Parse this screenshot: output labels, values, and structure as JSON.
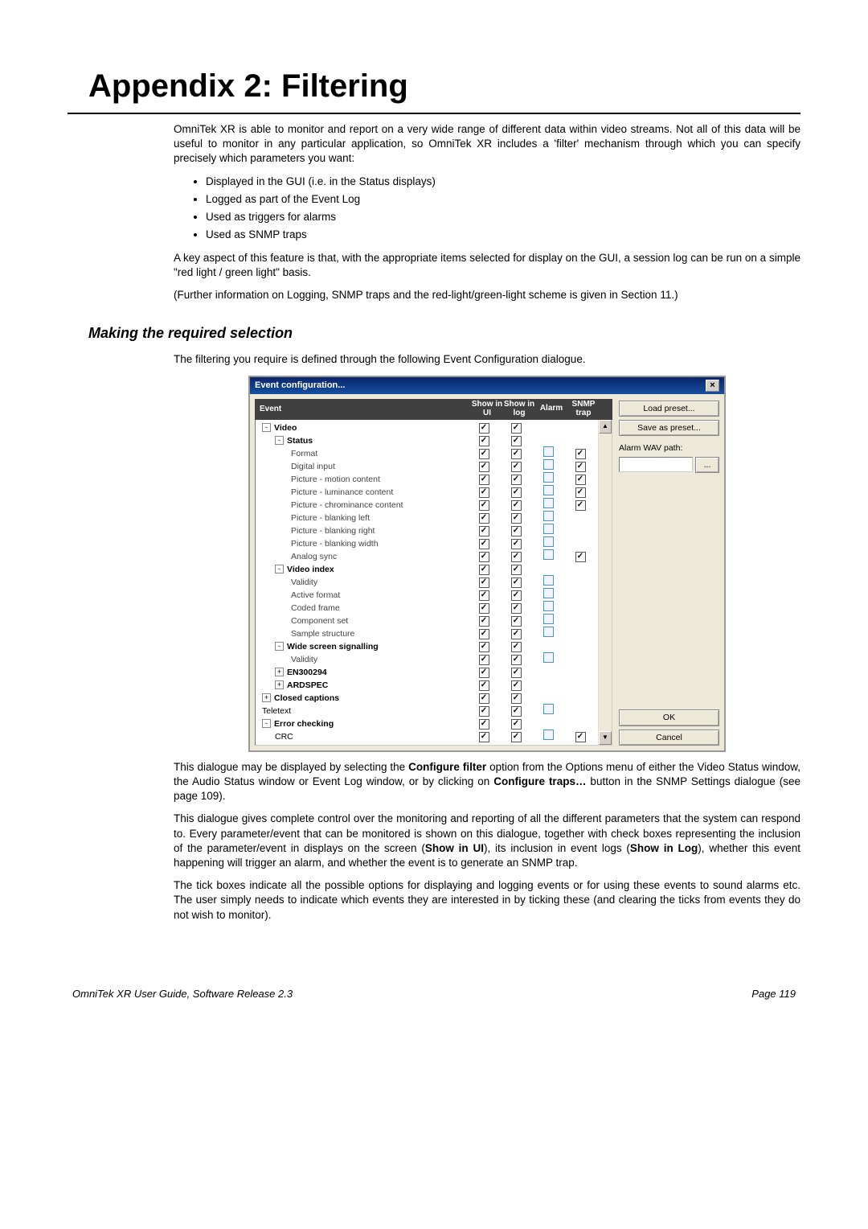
{
  "page_title": "Appendix 2: Filtering",
  "intro_para": "OmniTek XR is able to monitor and report on a very wide range of different data within video streams. Not all of this data will be useful to monitor in any particular application, so OmniTek XR includes a 'filter' mechanism through which you can specify precisely which parameters you want:",
  "bullets": [
    "Displayed in the GUI (i.e. in the Status displays)",
    "Logged as part of the Event Log",
    "Used as triggers for alarms",
    "Used as SNMP traps"
  ],
  "key_para": "A key aspect of this feature is that, with the appropriate items selected for display on the GUI, a session log can be run on a simple \"red light / green light\" basis.",
  "further_para": "(Further information on Logging, SNMP traps and the red-light/green-light scheme is given in Section 11.)",
  "section_heading": "Making the required selection",
  "section_intro": "The filtering you require is defined through the following Event Configuration dialogue.",
  "dialog": {
    "title": "Event configuration...",
    "headers": {
      "event": "Event",
      "ui": "Show in UI",
      "log": "Show in log",
      "alarm": "Alarm",
      "snmp": "SNMP trap"
    },
    "rows": [
      {
        "label": "Video",
        "indent": 1,
        "bold": true,
        "toggle": "-",
        "ui": "on",
        "log": "on",
        "alarm": "",
        "snmp": ""
      },
      {
        "label": "Status",
        "indent": 2,
        "bold": true,
        "toggle": "-",
        "ui": "on",
        "log": "on",
        "alarm": "",
        "snmp": ""
      },
      {
        "label": "Format",
        "indent": 3,
        "bold": false,
        "toggle": "",
        "ui": "on",
        "log": "on",
        "alarm": "off",
        "snmp": "on"
      },
      {
        "label": "Digital input",
        "indent": 3,
        "bold": false,
        "toggle": "",
        "ui": "on",
        "log": "on",
        "alarm": "off",
        "snmp": "on"
      },
      {
        "label": "Picture - motion content",
        "indent": 3,
        "bold": false,
        "toggle": "",
        "ui": "on",
        "log": "on",
        "alarm": "off",
        "snmp": "on"
      },
      {
        "label": "Picture - luminance content",
        "indent": 3,
        "bold": false,
        "toggle": "",
        "ui": "on",
        "log": "on",
        "alarm": "off",
        "snmp": "on"
      },
      {
        "label": "Picture - chrominance content",
        "indent": 3,
        "bold": false,
        "toggle": "",
        "ui": "on",
        "log": "on",
        "alarm": "off",
        "snmp": "on"
      },
      {
        "label": "Picture - blanking left",
        "indent": 3,
        "bold": false,
        "toggle": "",
        "ui": "on",
        "log": "on",
        "alarm": "off",
        "snmp": ""
      },
      {
        "label": "Picture - blanking right",
        "indent": 3,
        "bold": false,
        "toggle": "",
        "ui": "on",
        "log": "on",
        "alarm": "off",
        "snmp": ""
      },
      {
        "label": "Picture - blanking width",
        "indent": 3,
        "bold": false,
        "toggle": "",
        "ui": "on",
        "log": "on",
        "alarm": "off",
        "snmp": ""
      },
      {
        "label": "Analog sync",
        "indent": 3,
        "bold": false,
        "toggle": "",
        "ui": "on",
        "log": "on",
        "alarm": "off",
        "snmp": "on"
      },
      {
        "label": "Video index",
        "indent": 2,
        "bold": true,
        "toggle": "-",
        "ui": "on",
        "log": "on",
        "alarm": "",
        "snmp": ""
      },
      {
        "label": "Validity",
        "indent": 3,
        "bold": false,
        "toggle": "",
        "ui": "on",
        "log": "on",
        "alarm": "off",
        "snmp": ""
      },
      {
        "label": "Active format",
        "indent": 3,
        "bold": false,
        "toggle": "",
        "ui": "on",
        "log": "on",
        "alarm": "off",
        "snmp": ""
      },
      {
        "label": "Coded frame",
        "indent": 3,
        "bold": false,
        "toggle": "",
        "ui": "on",
        "log": "on",
        "alarm": "off",
        "snmp": ""
      },
      {
        "label": "Component set",
        "indent": 3,
        "bold": false,
        "toggle": "",
        "ui": "on",
        "log": "on",
        "alarm": "off",
        "snmp": ""
      },
      {
        "label": "Sample structure",
        "indent": 3,
        "bold": false,
        "toggle": "",
        "ui": "on",
        "log": "on",
        "alarm": "off",
        "snmp": ""
      },
      {
        "label": "Wide screen signalling",
        "indent": 2,
        "bold": true,
        "toggle": "-",
        "ui": "on",
        "log": "on",
        "alarm": "",
        "snmp": ""
      },
      {
        "label": "Validity",
        "indent": 3,
        "bold": false,
        "toggle": "",
        "ui": "on",
        "log": "on",
        "alarm": "off",
        "snmp": ""
      },
      {
        "label": "EN300294",
        "indent": 2,
        "bold": true,
        "toggle": "+",
        "ui": "on",
        "log": "on",
        "alarm": "",
        "snmp": ""
      },
      {
        "label": "ARDSPEC",
        "indent": 2,
        "bold": true,
        "toggle": "+",
        "ui": "on",
        "log": "on",
        "alarm": "",
        "snmp": ""
      },
      {
        "label": "Closed captions",
        "indent": 1,
        "bold": true,
        "toggle": "+",
        "ui": "on",
        "log": "on",
        "alarm": "",
        "snmp": ""
      },
      {
        "label": "Teletext",
        "indent": 1,
        "bold": false,
        "toggle": "",
        "ui": "on",
        "log": "on",
        "alarm": "off",
        "snmp": ""
      },
      {
        "label": "Error checking",
        "indent": 1,
        "bold": true,
        "toggle": "-",
        "ui": "on",
        "log": "on",
        "alarm": "",
        "snmp": ""
      },
      {
        "label": "CRC",
        "indent": 2,
        "bold": false,
        "toggle": "",
        "ui": "on",
        "log": "on",
        "alarm": "off",
        "snmp": "on"
      }
    ],
    "buttons": {
      "load": "Load preset...",
      "save": "Save as preset...",
      "alarm_label": "Alarm WAV path:",
      "dots": "...",
      "ok": "OK",
      "cancel": "Cancel"
    }
  },
  "para_after_1_pre": "This dialogue may be displayed by selecting the ",
  "para_after_1_bold1": "Configure filter",
  "para_after_1_mid": " option from the Options menu of either the Video Status window, the Audio Status window or Event Log window, or by clicking on ",
  "para_after_1_bold2": "Configure traps…",
  "para_after_1_post": " button in the SNMP Settings dialogue (see page 109).",
  "para_after_2_pre": "This dialogue gives complete control over the monitoring and reporting of all the different parameters that the system can respond to. Every parameter/event that can be monitored is shown on this dialogue, together with check boxes representing the inclusion of the parameter/event in displays on the screen (",
  "para_after_2_bold1": "Show in UI",
  "para_after_2_mid1": "), its inclusion in event logs (",
  "para_after_2_bold2": "Show in Log",
  "para_after_2_post": "), whether this event happening will trigger an alarm, and whether the event is to generate an SNMP trap.",
  "para_after_3": "The tick boxes indicate all the possible options for displaying and logging events or for using these events to sound alarms etc. The user simply needs to indicate which events they are interested in by ticking these (and clearing the ticks from events they do not wish to monitor).",
  "footer_left": "OmniTek XR User Guide, Software Release 2.3",
  "footer_right": "Page 119"
}
